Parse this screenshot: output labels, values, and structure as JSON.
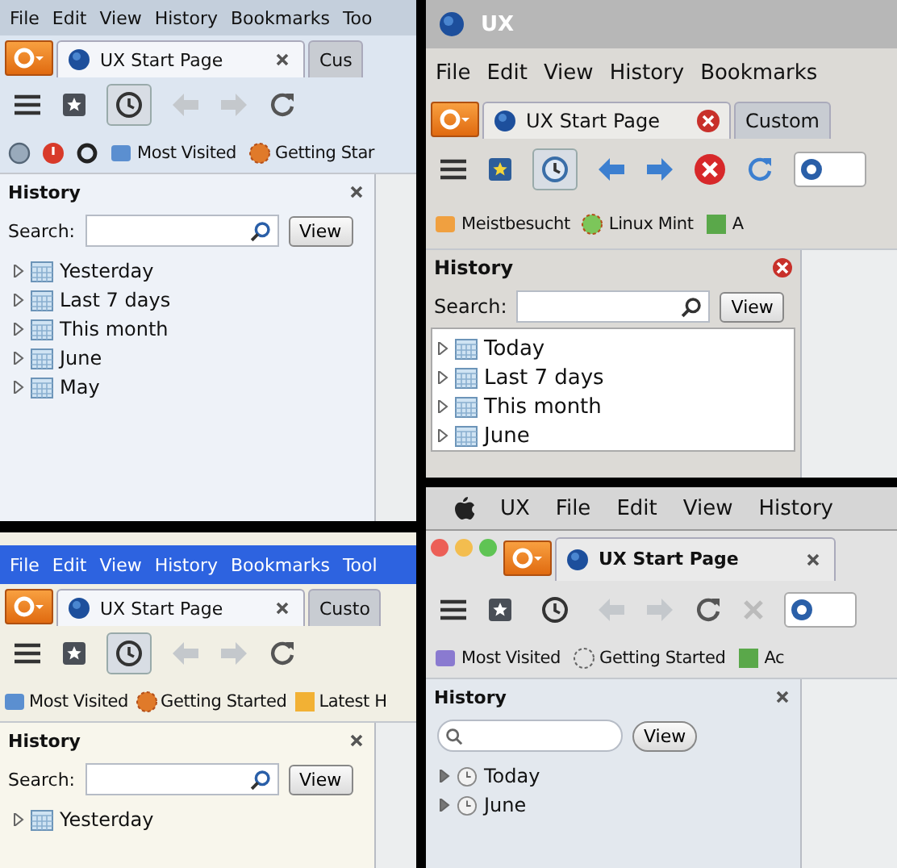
{
  "panels": [
    {
      "kind": "windows",
      "menu": [
        "File",
        "Edit",
        "View",
        "History",
        "Bookmarks",
        "Too"
      ],
      "tabs": [
        {
          "label": "UX Start Page",
          "selected": true
        },
        {
          "label": "Cus",
          "selected": false
        }
      ],
      "history_button_pressed": true,
      "bookmarks": [
        "Most Visited",
        "Getting Star"
      ],
      "sidebar": {
        "title": "History",
        "search_label": "Search:",
        "view_button": "View",
        "items": [
          {
            "label": "Yesterday",
            "expanded": false
          },
          {
            "label": "Last 7 days",
            "expanded": false
          },
          {
            "label": "This month",
            "expanded": false
          },
          {
            "label": "June",
            "expanded": false
          },
          {
            "label": "May",
            "expanded": false
          }
        ]
      }
    },
    {
      "kind": "linux",
      "window_title": "UX",
      "menu": [
        "File",
        "Edit",
        "View",
        "History",
        "Bookmarks"
      ],
      "tabs": [
        {
          "label": "UX Start Page",
          "selected": true
        },
        {
          "label": "Custom",
          "selected": false
        }
      ],
      "history_button_pressed": true,
      "bookmarks": [
        "Meistbesucht",
        "Linux Mint",
        "A"
      ],
      "sidebar": {
        "title": "History",
        "search_label": "Search:",
        "view_button": "View",
        "items": [
          {
            "label": "Today",
            "expanded": false
          },
          {
            "label": "Last 7 days",
            "expanded": false
          },
          {
            "label": "This month",
            "expanded": false
          },
          {
            "label": "June",
            "expanded": false
          }
        ]
      }
    },
    {
      "kind": "mac",
      "menu": [
        "UX",
        "File",
        "Edit",
        "View",
        "History"
      ],
      "tabs": [
        {
          "label": "UX Start Page",
          "selected": true
        }
      ],
      "history_button_pressed": false,
      "bookmarks": [
        "Most Visited",
        "Getting Started",
        "Ac"
      ],
      "sidebar": {
        "title": "History",
        "view_button": "View",
        "items": [
          {
            "label": "Today",
            "expanded": false
          },
          {
            "label": "June",
            "expanded": false
          }
        ]
      }
    },
    {
      "kind": "xp",
      "menu": [
        "File",
        "Edit",
        "View",
        "History",
        "Bookmarks",
        "Tool"
      ],
      "tabs": [
        {
          "label": "UX Start Page",
          "selected": true
        },
        {
          "label": "Custo",
          "selected": false
        }
      ],
      "history_button_pressed": true,
      "bookmarks": [
        "Most Visited",
        "Getting Started",
        "Latest H"
      ],
      "sidebar": {
        "title": "History",
        "search_label": "Search:",
        "view_button": "View",
        "items": [
          {
            "label": "Yesterday",
            "expanded": false
          }
        ]
      }
    }
  ]
}
